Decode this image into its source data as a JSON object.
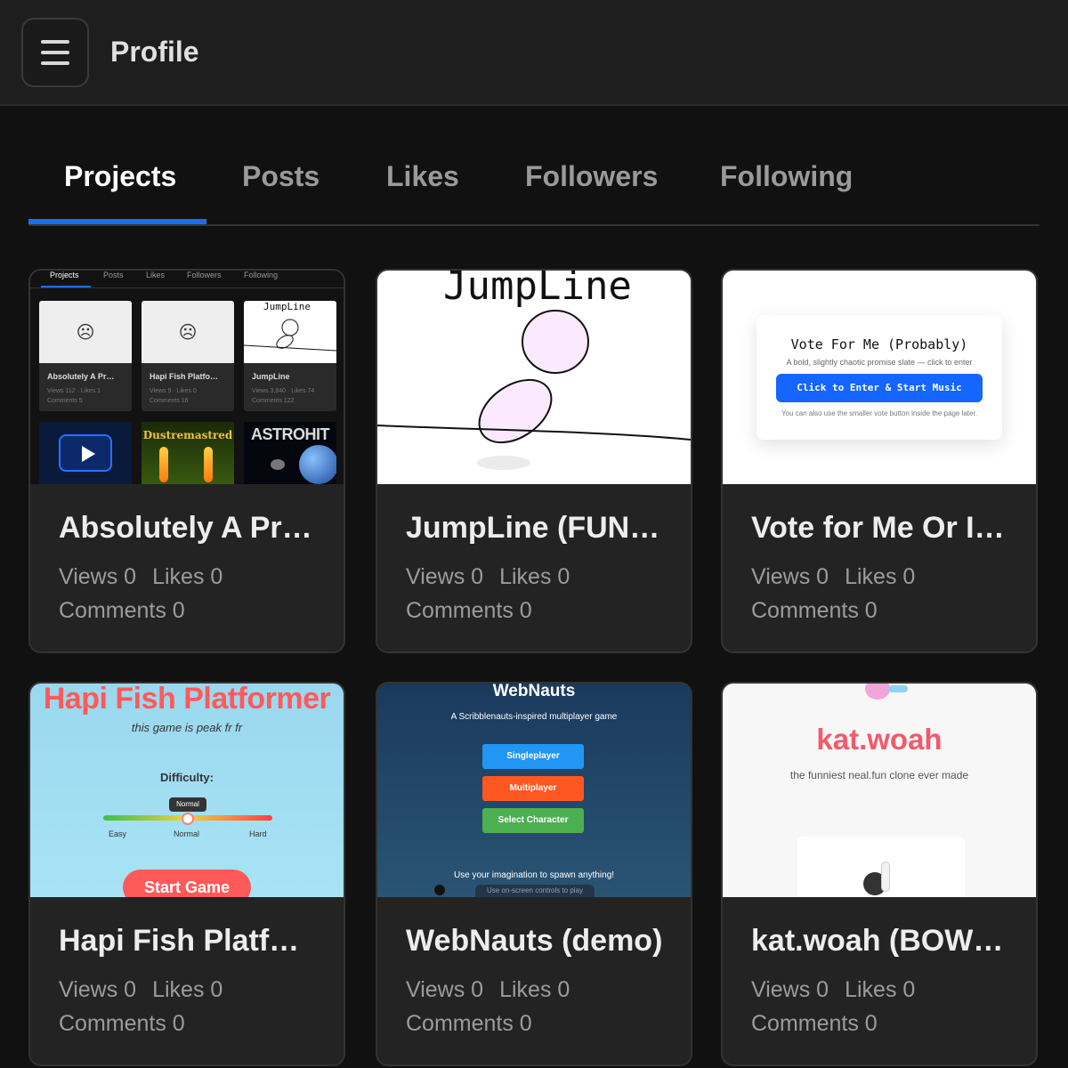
{
  "header": {
    "title": "Profile"
  },
  "tabs": [
    {
      "label": "Projects",
      "active": true
    },
    {
      "label": "Posts",
      "active": false
    },
    {
      "label": "Likes",
      "active": false
    },
    {
      "label": "Followers",
      "active": false
    },
    {
      "label": "Following",
      "active": false
    }
  ],
  "projects": [
    {
      "title": "Absolutely A Pr…",
      "views": "Views 0",
      "likes": "Likes 0",
      "comments": "Comments 0",
      "thumb": {
        "tabs": [
          "Projects",
          "Posts",
          "Likes",
          "Followers",
          "Following"
        ],
        "cards": [
          {
            "title": "Absolutely A Pr…",
            "stats1": "Views 112 · Likes 1",
            "stats2": "Comments 5"
          },
          {
            "title": "Hapi Fish Platfo…",
            "stats1": "Views 9 · Likes 0",
            "stats2": "Comments 16"
          },
          {
            "title": "JumpLine",
            "stats1": "Views 3,840 · Likes 74",
            "stats2": "Comments 122"
          }
        ],
        "jumpline_label": "JumpLine",
        "game_titles": [
          "Dustremastred",
          "ASTROHIT"
        ]
      }
    },
    {
      "title": "JumpLine (FUN …",
      "views": "Views 0",
      "likes": "Likes 0",
      "comments": "Comments 0",
      "thumb": {
        "title": "JumpLine"
      }
    },
    {
      "title": "Vote for Me Or I …",
      "views": "Views 0",
      "likes": "Likes 0",
      "comments": "Comments 0",
      "thumb": {
        "title": "Vote For Me (Probably)",
        "subtitle": "A bold, slightly chaotic promise slate — click to enter",
        "button": "Click to Enter & Start Music",
        "note": "You can also use the smaller vote button inside the page later."
      }
    },
    {
      "title": "Hapi Fish Platfo…",
      "views": "Views 0",
      "likes": "Likes 0",
      "comments": "Comments 0",
      "thumb": {
        "title": "Hapi Fish Platformer",
        "subtitle": "this game is peak fr fr",
        "difficulty_label": "Difficulty:",
        "difficulty_value": "Normal",
        "levels": [
          "Easy",
          "Normal",
          "Hard"
        ],
        "difficulty_level": 0.5,
        "start_button": "Start Game"
      }
    },
    {
      "title": "WebNauts (demo)",
      "views": "Views 0",
      "likes": "Likes 0",
      "comments": "Comments 0",
      "thumb": {
        "title": "WebNauts",
        "subtitle": "A Scribblenauts-inspired multiplayer game",
        "buttons": [
          {
            "label": "Singleplayer",
            "color": "#2196f3"
          },
          {
            "label": "Multiplayer",
            "color": "#ff5722"
          },
          {
            "label": "Select Character",
            "color": "#4caf50"
          }
        ],
        "footer": "Use your imagination to spawn anything!",
        "hint": "Use on-screen controls to play"
      }
    },
    {
      "title": "kat.woah (BOWL…",
      "views": "Views 0",
      "likes": "Likes 0",
      "comments": "Comments 0",
      "thumb": {
        "title": "kat.woah",
        "subtitle": "the funniest neal.fun clone ever made"
      }
    }
  ],
  "colors": {
    "accent": "#1a6fe8",
    "background": "#111111",
    "card": "#232323"
  }
}
